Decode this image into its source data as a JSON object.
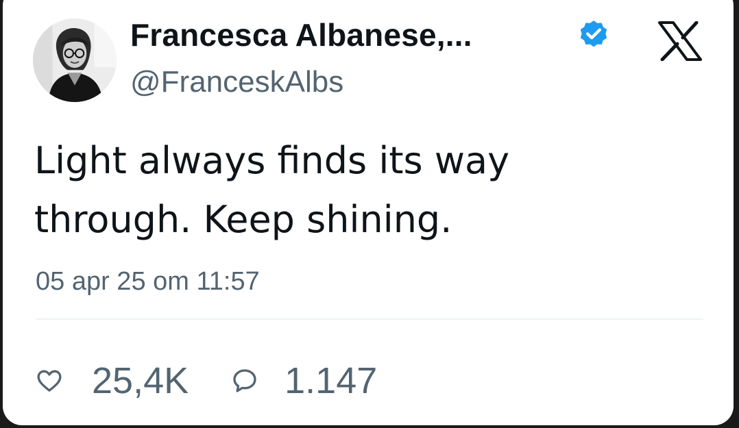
{
  "tweet": {
    "author": {
      "display_name": "Francesca Albanese,...",
      "handle": "@FranceskAlbs",
      "verified": true,
      "verified_color": "#1d9bf0",
      "avatar_icon": "profile-photo"
    },
    "platform_icon": "x-logo",
    "text_lines": [
      "Light always finds its way",
      "through. Keep shining."
    ],
    "timestamp": "05 apr 25 om 11:57",
    "stats": {
      "likes": "25,4K",
      "likes_icon": "heart-outline",
      "replies": "1.147",
      "replies_icon": "speech-bubble-outline"
    }
  },
  "colors": {
    "primary_text": "#0f1419",
    "secondary_text": "#536471",
    "card_background": "#ffffff",
    "divider": "#eff3f4"
  }
}
